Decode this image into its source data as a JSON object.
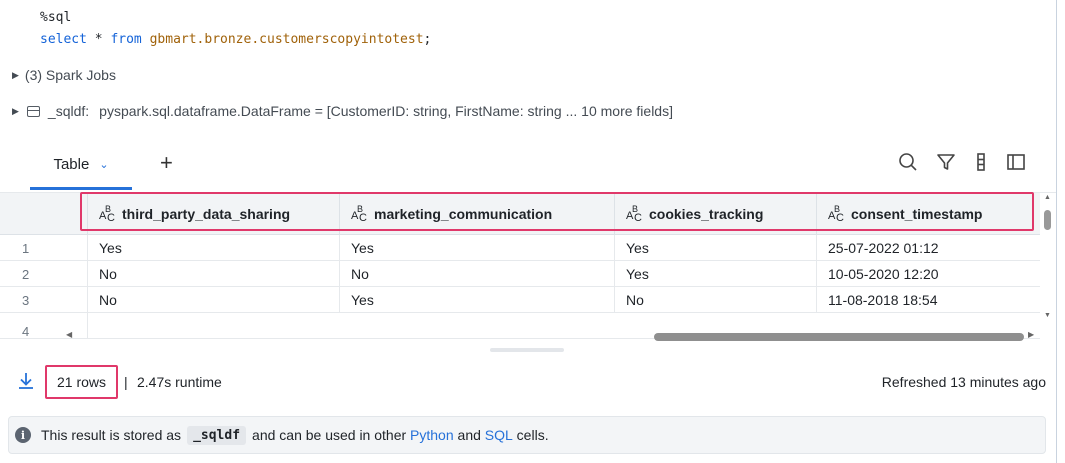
{
  "code": {
    "magic": "%sql",
    "kw_select": "select",
    "star": " * ",
    "kw_from": "from",
    "table": "gbmart.bronze.customerscopyintotest",
    "semicolon": ";"
  },
  "spark_jobs": {
    "label": "(3) Spark Jobs"
  },
  "dataframe": {
    "name": "_sqldf:",
    "type": "pyspark.sql.dataframe.DataFrame = [CustomerID: string, FirstName: string ... 10 more fields]"
  },
  "tabs": {
    "table_label": "Table",
    "add_label": "+"
  },
  "toolbar_icons": [
    "search-icon",
    "filter-icon",
    "column-visibility-icon",
    "sidebar-panel-icon"
  ],
  "table": {
    "columns": [
      {
        "name": "third_party_data_sharing",
        "type_icon": "string-type-icon"
      },
      {
        "name": "marketing_communication",
        "type_icon": "string-type-icon"
      },
      {
        "name": "cookies_tracking",
        "type_icon": "string-type-icon"
      },
      {
        "name": "consent_timestamp",
        "type_icon": "string-type-icon"
      }
    ],
    "type_badge": {
      "a": "A",
      "b": "B",
      "c": "C"
    },
    "rows": [
      {
        "idx": "1",
        "cells": [
          "Yes",
          "Yes",
          "Yes",
          "25-07-2022 01:12"
        ]
      },
      {
        "idx": "2",
        "cells": [
          "No",
          "No",
          "Yes",
          "10-05-2020 12:20"
        ]
      },
      {
        "idx": "3",
        "cells": [
          "No",
          "Yes",
          "No",
          "11-08-2018 18:54"
        ]
      },
      {
        "idx": "4",
        "cells": [
          "",
          "",
          "",
          ""
        ]
      }
    ]
  },
  "footer": {
    "rows": "21 rows",
    "separator": "|",
    "runtime": "2.47s runtime",
    "refreshed": "Refreshed 13 minutes ago"
  },
  "info": {
    "text1": "This result is stored as",
    "var": "_sqldf",
    "text2": "and can be used in other ",
    "python": "Python",
    "and": " and ",
    "sql": "SQL",
    "text3": " cells."
  },
  "colors": {
    "accent": "#2671d9",
    "highlight": "#e0386a",
    "keyword": "#1463d8",
    "table_name": "#a0620a"
  }
}
